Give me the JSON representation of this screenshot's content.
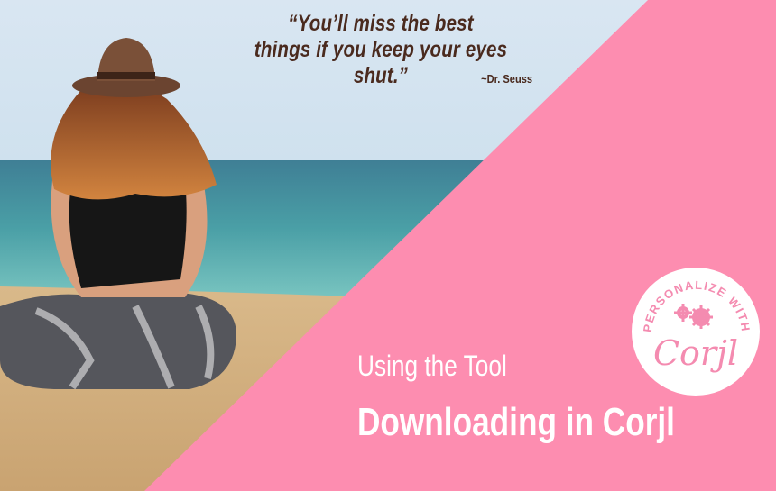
{
  "quote": {
    "line1": "“You’ll miss the best",
    "line2": "things if you keep your eyes shut.”",
    "author": "~Dr. Seuss"
  },
  "headline": {
    "subtitle": "Using the Tool",
    "title": "Downloading in Corjl"
  },
  "badge": {
    "top_text": "PERSONALIZE WITH",
    "logo_text": "Corjl",
    "icon": "gears-icon"
  },
  "colors": {
    "pink": "#fd8db0",
    "quote_text": "#4a2a1e",
    "badge_bg": "#ffffff",
    "badge_accent": "#f48bb0"
  }
}
